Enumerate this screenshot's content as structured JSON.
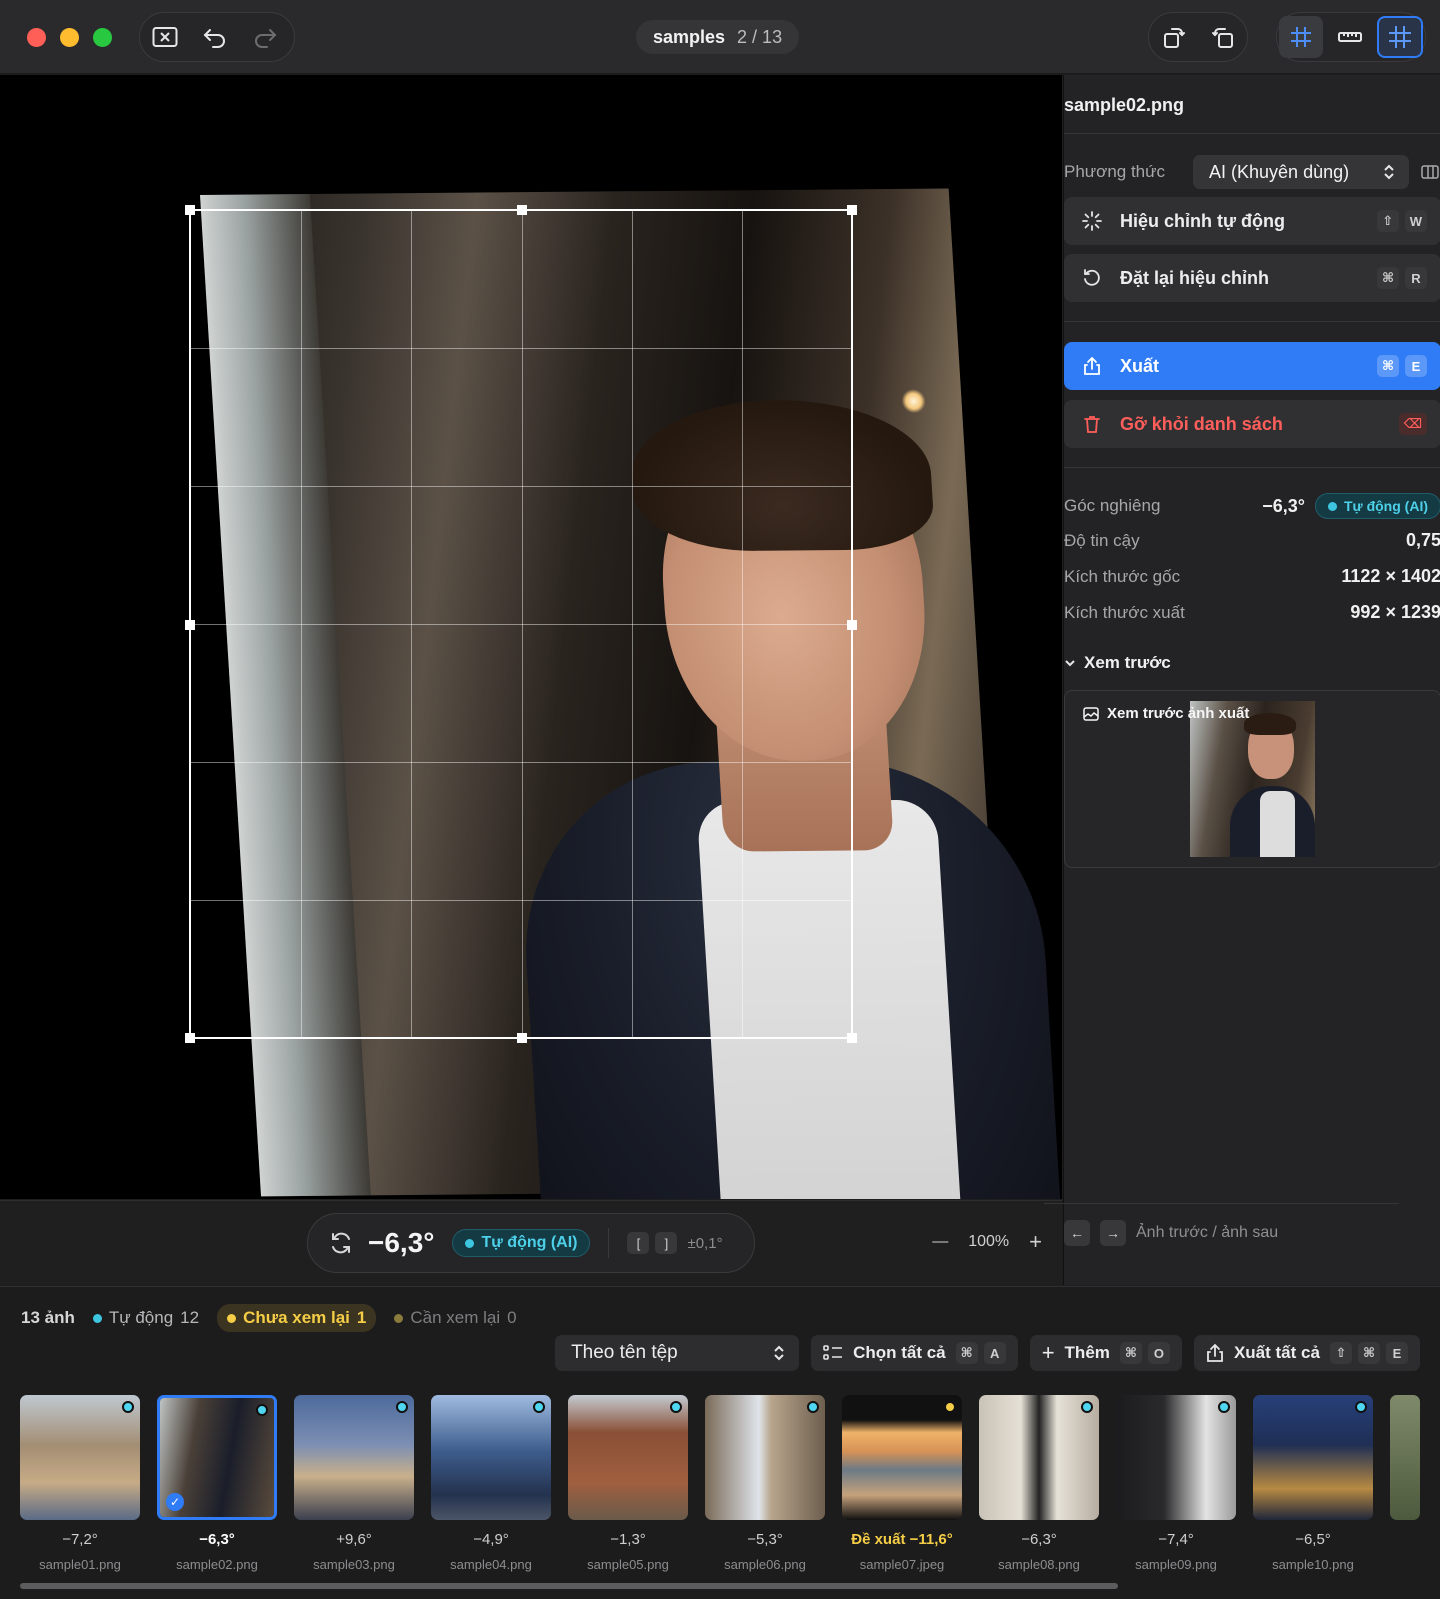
{
  "titlebar": {
    "folder": "samples",
    "counter": "2 / 13"
  },
  "canvas": {
    "angle": "−6,3°",
    "mode_badge": "Tự động (AI)",
    "nudge_left": "[",
    "nudge_right": "]",
    "step": "±0,1°",
    "zoom_minus": "—",
    "zoom_level": "100%",
    "zoom_plus": "+"
  },
  "sidebar": {
    "filename": "sample02.png",
    "method_label": "Phương thức",
    "method_value": "AI (Khuyên dùng)",
    "auto_fix": {
      "label": "Hiệu chỉnh tự động",
      "k1": "⇧",
      "k2": "W"
    },
    "reset_fix": {
      "label": "Đặt lại hiệu chỉnh",
      "k1": "⌘",
      "k2": "R"
    },
    "export": {
      "label": "Xuất",
      "k1": "⌘",
      "k2": "E"
    },
    "remove": {
      "label": "Gỡ khỏi danh sách"
    },
    "tilt_label": "Góc nghiêng",
    "tilt_value": "−6,3°",
    "tilt_badge": "Tự động (AI)",
    "confidence_label": "Độ tin cậy",
    "confidence_value": "0,75",
    "orig_size_label": "Kích thước gốc",
    "orig_size_value": "1122 × 1402",
    "out_size_label": "Kích thước xuất",
    "out_size_value": "992 × 1239",
    "preview_section": "Xem trước",
    "preview_caption": "Xem trước ảnh xuất",
    "compare_label": "Ảnh trước / ảnh sau"
  },
  "filmstrip": {
    "total": "13 ảnh",
    "auto_label": "Tự động",
    "auto_count": "12",
    "unreviewed_label": "Chưa xem lại",
    "unreviewed_count": "1",
    "review_label": "Cần xem lại",
    "review_count": "0",
    "sort_value": "Theo tên tệp",
    "select_all": {
      "label": "Chọn tất cả",
      "k1": "⌘",
      "k2": "A"
    },
    "add": {
      "label": "Thêm",
      "k1": "⌘",
      "k2": "O"
    },
    "export_all": {
      "label": "Xuất tất cả",
      "k1": "⇧",
      "k2": "⌘",
      "k3": "E"
    },
    "items": [
      {
        "angle": "−7,2°",
        "name": "sample01.png"
      },
      {
        "angle": "−6,3°",
        "name": "sample02.png"
      },
      {
        "angle": "+9,6°",
        "name": "sample03.png"
      },
      {
        "angle": "−4,9°",
        "name": "sample04.png"
      },
      {
        "angle": "−1,3°",
        "name": "sample05.png"
      },
      {
        "angle": "−5,3°",
        "name": "sample06.png"
      },
      {
        "angle": "Đề xuất −11,6°",
        "name": "sample07.jpeg"
      },
      {
        "angle": "−6,3°",
        "name": "sample08.png"
      },
      {
        "angle": "−7,4°",
        "name": "sample09.png"
      },
      {
        "angle": "−6,5°",
        "name": "sample10.png"
      }
    ]
  },
  "colors": {
    "accent": "#2f7cf6",
    "ai_cyan": "#3dc6e0",
    "pending_yellow": "#f5cd46",
    "danger": "#ff5e5a"
  }
}
